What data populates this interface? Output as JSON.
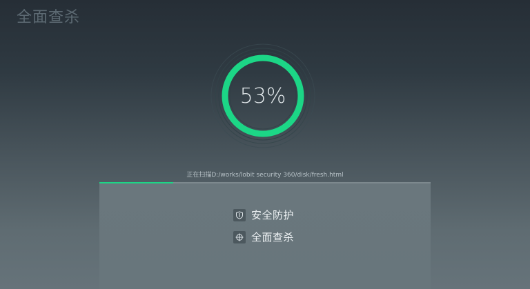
{
  "app": {
    "title": "全面查杀"
  },
  "scan": {
    "percent_label": "53%",
    "progress_fraction": 0.53,
    "status_text": "正在扫描D:/works/lobit security 360/disk/fresh.html"
  },
  "menu": {
    "items": [
      {
        "label": "安全防护",
        "icon": "shield-icon"
      },
      {
        "label": "全面查杀",
        "icon": "crosshair-icon"
      }
    ]
  },
  "colors": {
    "accent": "#1cd686",
    "ring_track": "#2a3540"
  }
}
